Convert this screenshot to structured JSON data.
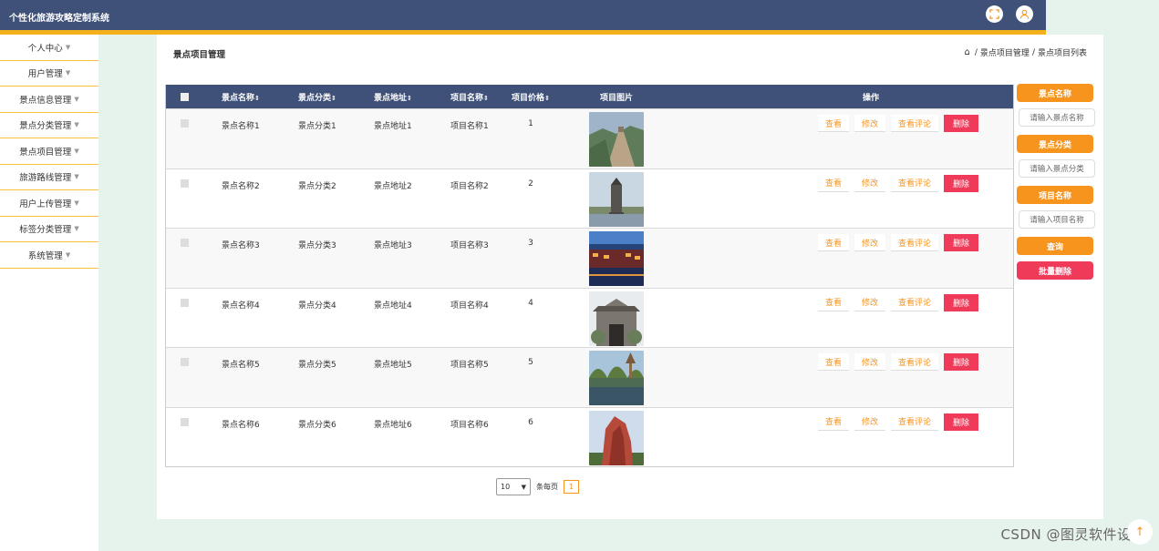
{
  "app": {
    "title": "个性化旅游攻略定制系统"
  },
  "header": {
    "fullscreen_icon": "fullscreen-icon",
    "user_icon": "user-icon"
  },
  "sidebar": {
    "items": [
      {
        "label": "个人中心"
      },
      {
        "label": "用户管理"
      },
      {
        "label": "景点信息管理"
      },
      {
        "label": "景点分类管理"
      },
      {
        "label": "景点项目管理"
      },
      {
        "label": "旅游路线管理"
      },
      {
        "label": "用户上传管理"
      },
      {
        "label": "标签分类管理"
      },
      {
        "label": "系统管理"
      }
    ],
    "caret": "▼"
  },
  "page": {
    "title": "景点项目管理",
    "breadcrumb": [
      "景点项目管理",
      "景点项目列表"
    ],
    "breadcrumb_sep": "/"
  },
  "table": {
    "sort_glyph": "⇕",
    "headers": {
      "name": "景点名称",
      "category": "景点分类",
      "address": "景点地址",
      "project": "项目名称",
      "price": "项目价格",
      "image": "项目图片",
      "ops": "操作"
    },
    "rows": [
      {
        "name": "景点名称1",
        "category": "景点分类1",
        "address": "景点地址1",
        "project": "项目名称1",
        "price": "1",
        "image_scene": "great-wall"
      },
      {
        "name": "景点名称2",
        "category": "景点分类2",
        "address": "景点地址2",
        "project": "项目名称2",
        "price": "2",
        "image_scene": "monument"
      },
      {
        "name": "景点名称3",
        "category": "景点分类3",
        "address": "景点地址3",
        "project": "项目名称3",
        "price": "3",
        "image_scene": "night-town"
      },
      {
        "name": "景点名称4",
        "category": "景点分类4",
        "address": "景点地址4",
        "project": "项目名称4",
        "price": "4",
        "image_scene": "temple-gate"
      },
      {
        "name": "景点名称5",
        "category": "景点分类5",
        "address": "景点地址5",
        "project": "项目名称5",
        "price": "5",
        "image_scene": "lake-trees"
      },
      {
        "name": "景点名称6",
        "category": "景点分类6",
        "address": "景点地址6",
        "project": "项目名称6",
        "price": "6",
        "image_scene": "red-rock"
      }
    ],
    "actions": {
      "view": "查看",
      "edit": "修改",
      "comments": "查看评论",
      "delete": "删除"
    }
  },
  "search": {
    "name_label": "景点名称",
    "name_placeholder": "请输入景点名称",
    "category_label": "景点分类",
    "category_placeholder": "请输入景点分类",
    "project_label": "项目名称",
    "project_placeholder": "请输入项目名称",
    "query_button": "查询",
    "batch_delete_button": "批量删除"
  },
  "pagination": {
    "page_size": "10",
    "per_page_label": "条每页",
    "current_page": "1"
  },
  "watermark": "CSDN @图灵软件设计",
  "colors": {
    "header": "#3f5178",
    "accent": "#f7941d",
    "danger": "#f03a5a",
    "strip": "#f5b11b",
    "background": "#e6f2ec"
  }
}
